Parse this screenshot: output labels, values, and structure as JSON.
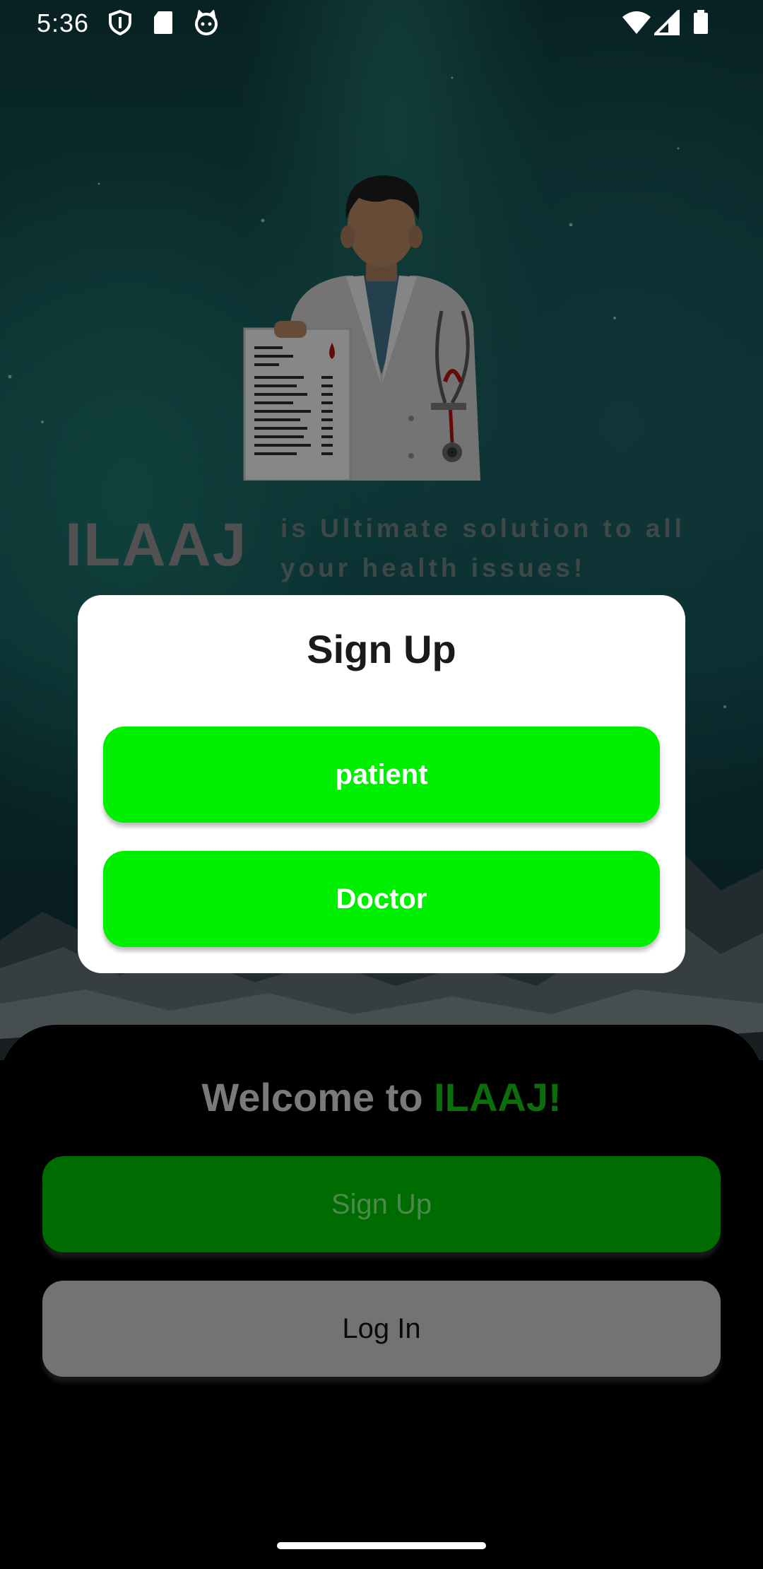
{
  "status_bar": {
    "time": "5:36",
    "icons": [
      "shield-icon",
      "sd-card-icon",
      "cat-face-icon",
      "wifi-icon",
      "signal-icon",
      "battery-icon"
    ]
  },
  "hero": {
    "brand": "ILAAJ",
    "tagline": "is Ultimate solution to all your health issues!"
  },
  "welcome": {
    "prefix": "Welcome to ",
    "app_name": "ILAAJ!"
  },
  "actions": {
    "sign_up_label": "Sign Up",
    "log_in_label": "Log In"
  },
  "dialog": {
    "title": "Sign Up",
    "options": [
      {
        "label": "patient"
      },
      {
        "label": "Doctor"
      }
    ]
  },
  "colors": {
    "option_green": "#00ee00",
    "sign_up_green": "#006b00",
    "welcome_accent": "#0b6e0b",
    "log_in_gray": "#737373"
  }
}
